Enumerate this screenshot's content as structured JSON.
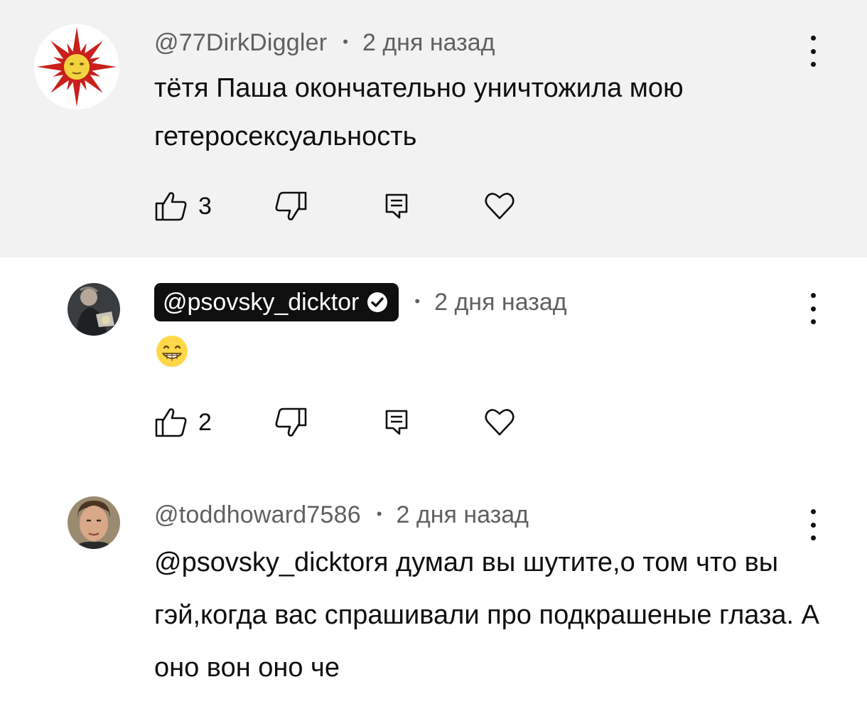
{
  "comments": [
    {
      "handle": "@77DirkDiggler",
      "separator": "•",
      "time": "2 дня назад",
      "avatar_icon": "sun-emblem-icon",
      "text": "тётя Паша окончательно уничтожила мою гетеросексуальность",
      "likes": "3"
    },
    {
      "handle": "@psovsky_dicktor",
      "separator": "•",
      "time": "2 дня назад",
      "avatar_icon": "user-photo",
      "verified_icon": "verified-check-icon",
      "emoji": "grinning-face-emoji",
      "likes": "2"
    },
    {
      "handle": "@toddhoward7586",
      "separator": "•",
      "time": "2 дня назад",
      "avatar_icon": "user-photo",
      "mention": "@psovsky_dicktor",
      "text": "я думал вы шутите,о том что вы гэй,когда вас спрашивали про подкрашеные глаза. А оно вон оно че"
    }
  ],
  "icons": {
    "like": "thumbs-up-icon",
    "dislike": "thumbs-down-icon",
    "reply": "reply-icon",
    "heart": "heart-icon",
    "menu": "more-vert-icon"
  },
  "colors": {
    "highlight_bg": "#f2f2f2",
    "secondary_text": "#606060",
    "primary_text": "#0f0f0f",
    "chip_bg": "#0f0f0f",
    "sun_red": "#c9201c",
    "sun_yellow": "#f2d33f"
  }
}
